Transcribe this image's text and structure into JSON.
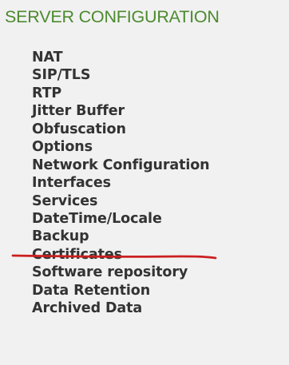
{
  "section": {
    "title": "SERVER CONFIGURATION"
  },
  "menu": {
    "items": [
      {
        "label": "NAT"
      },
      {
        "label": "SIP/TLS"
      },
      {
        "label": "RTP"
      },
      {
        "label": "Jitter Buffer"
      },
      {
        "label": "Obfuscation"
      },
      {
        "label": "Options"
      },
      {
        "label": "Network Configuration"
      },
      {
        "label": "Interfaces"
      },
      {
        "label": "Services"
      },
      {
        "label": "DateTime/Locale"
      },
      {
        "label": "Backup"
      },
      {
        "label": "Certificates"
      },
      {
        "label": "Software repository"
      },
      {
        "label": "Data Retention"
      },
      {
        "label": "Archived Data"
      }
    ]
  },
  "colors": {
    "title": "#4c8a2e",
    "menu_text": "#333333",
    "annotation": "#cc1f1f",
    "background": "#f1f1f1"
  }
}
